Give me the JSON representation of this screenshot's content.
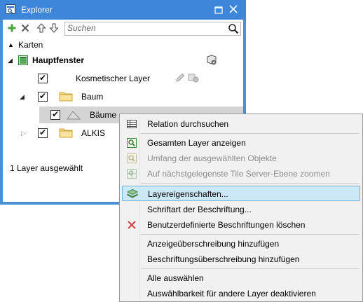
{
  "window": {
    "title": "Explorer",
    "icons": {
      "app": "explorer-app-icon",
      "restore": "restore-icon",
      "close": "close-icon"
    }
  },
  "toolbar": {
    "icons": [
      "add-icon",
      "remove-icon",
      "move-up-icon",
      "move-down-icon",
      "search-icon"
    ],
    "search_placeholder": "Suchen"
  },
  "section": {
    "label": "Karten"
  },
  "tree": {
    "map": {
      "label": "Hauptfenster",
      "icon": "map-icon",
      "action_icon": "map-properties-icon"
    },
    "layers": [
      {
        "label": "Kosmetischer Layer",
        "checked": true,
        "icons": [
          "edit-icon",
          "style-icon"
        ]
      },
      {
        "label": "Baum",
        "checked": true,
        "expanded": true,
        "icon": "folder-icon"
      },
      {
        "label": "Bäume",
        "checked": true,
        "selected": true,
        "icon": "region-layer-icon",
        "icons": [
          "edit-icon",
          "style-icon",
          "label-icon"
        ]
      },
      {
        "label": "ALKIS",
        "checked": true,
        "expanded": false,
        "icon": "folder-icon"
      }
    ]
  },
  "status": {
    "text": "1 Layer ausgewählt"
  },
  "context_menu": {
    "items": [
      {
        "label": "Relation durchsuchen",
        "icon": "table-icon",
        "enabled": true
      },
      {
        "label": "Gesamten Layer anzeigen",
        "icon": "zoom-layer-icon",
        "enabled": true
      },
      {
        "label": "Umfang der ausgewählten Objekte",
        "icon": "zoom-selection-icon",
        "enabled": false
      },
      {
        "label": "Auf nächstgelegenste Tile Server-Ebene zoomen",
        "icon": "tile-zoom-icon",
        "enabled": false
      },
      {
        "label": "Layereigenschaften...",
        "icon": "layers-icon",
        "enabled": true,
        "highlighted": true
      },
      {
        "label": "Schriftart der Beschriftung...",
        "icon": "",
        "enabled": true
      },
      {
        "label": "Benutzerdefinierte Beschriftungen löschen",
        "icon": "delete-icon",
        "enabled": true
      },
      {
        "label": "Anzeigeüberschreibung hinzufügen",
        "icon": "",
        "enabled": true
      },
      {
        "label": "Beschriftungsüberschreibung hinzufügen",
        "icon": "",
        "enabled": true
      },
      {
        "label": "Alle auswählen",
        "icon": "",
        "enabled": true
      },
      {
        "label": "Auswählbarkeit für andere Layer deaktivieren",
        "icon": "",
        "enabled": true
      }
    ]
  }
}
